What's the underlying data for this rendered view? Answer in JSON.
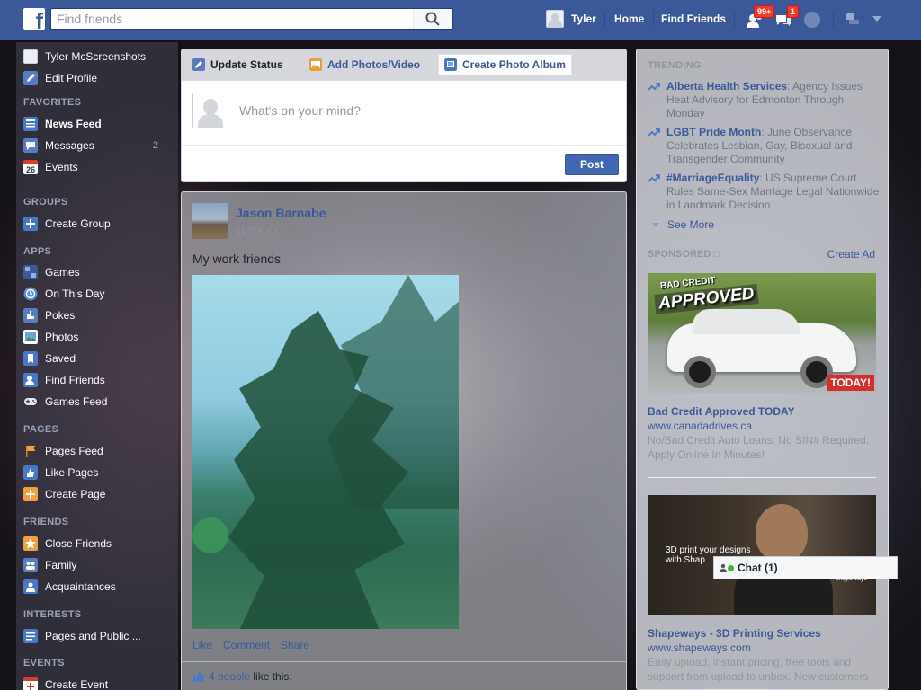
{
  "topbar": {
    "logo": "f",
    "search_placeholder": "Find friends",
    "user_name": "Tyler",
    "home": "Home",
    "find_friends": "Find Friends",
    "friend_requests_badge": "99+",
    "messages_badge": "1"
  },
  "leftnav": {
    "profile_name": "Tyler McScreenshots",
    "edit_profile": "Edit Profile",
    "favorites_head": "FAVORITES",
    "favorites": [
      {
        "label": "News Feed",
        "icon": "news-feed-icon",
        "count": ""
      },
      {
        "label": "Messages",
        "icon": "messages-icon",
        "count": "2"
      },
      {
        "label": "Events",
        "icon": "calendar-icon",
        "count": "",
        "icon_text": "26"
      }
    ],
    "groups_head": "GROUPS",
    "groups": [
      {
        "label": "Create Group",
        "icon": "create-group-icon"
      }
    ],
    "apps_head": "APPS",
    "apps": [
      {
        "label": "Games",
        "icon": "games-icon"
      },
      {
        "label": "On This Day",
        "icon": "on-this-day-icon"
      },
      {
        "label": "Pokes",
        "icon": "pokes-icon"
      },
      {
        "label": "Photos",
        "icon": "photos-icon"
      },
      {
        "label": "Saved",
        "icon": "saved-icon"
      },
      {
        "label": "Find Friends",
        "icon": "find-friends-icon"
      },
      {
        "label": "Games Feed",
        "icon": "games-feed-icon"
      }
    ],
    "pages_head": "PAGES",
    "pages": [
      {
        "label": "Pages Feed",
        "icon": "pages-feed-icon"
      },
      {
        "label": "Like Pages",
        "icon": "like-pages-icon"
      },
      {
        "label": "Create Page",
        "icon": "create-page-icon"
      }
    ],
    "friends_head": "FRIENDS",
    "friends": [
      {
        "label": "Close Friends",
        "icon": "close-friends-icon"
      },
      {
        "label": "Family",
        "icon": "family-icon"
      },
      {
        "label": "Acquaintances",
        "icon": "acquaintances-icon"
      }
    ],
    "interests_head": "INTERESTS",
    "interests": [
      {
        "label": "Pages and Public ...",
        "icon": "interests-icon"
      }
    ],
    "events_head": "EVENTS",
    "events": [
      {
        "label": "Create Event",
        "icon": "create-event-icon"
      }
    ]
  },
  "composer": {
    "tab_status": "Update Status",
    "tab_photos": "Add Photos/Video",
    "tab_album": "Create Photo Album",
    "placeholder": "What's on your mind?",
    "post": "Post"
  },
  "story": {
    "author": "Jason Barnabe",
    "time": "11 hrs",
    "text": "My work friends",
    "like": "Like",
    "comment": "Comment",
    "share": "Share",
    "likes_count": "4 people",
    "likes_suffix": " like this."
  },
  "rightcol": {
    "trending_head": "TRENDING",
    "trends": [
      {
        "topic": "Alberta Health Services",
        "desc": ": Agency Issues Heat Advisory for Edmonton Through Monday"
      },
      {
        "topic": "LGBT Pride Month",
        "desc": ": June Observance Celebrates Lesbian, Gay, Bisexual and Transgender Community"
      },
      {
        "topic": "#MarriageEquality",
        "desc": ": US Supreme Court Rules Same-Sex Marriage Legal Nationwide in Landmark Decision"
      }
    ],
    "see_more": "See More",
    "sponsored": "SPONSORED",
    "create_ad": "Create Ad",
    "ads": [
      {
        "title": "Bad Credit Approved TODAY",
        "url": "www.canadadrives.ca",
        "desc": "No/Bad Credit Auto Loans. No SIN# Required. Apply Online In Minutes!",
        "img_text_1": "BAD CREDIT",
        "img_text_2": "APPROVED",
        "img_text_3": "TODAY!"
      },
      {
        "title": "Shapeways - 3D Printing Services",
        "url": "www.shapeways.com",
        "desc": "Easy upload, instant pricing, free tools and support from upload to unbox. New customers",
        "img_text_1": "3D print your designs",
        "img_text_2": "with Shap",
        "img_text_3": "shapeways"
      }
    ]
  },
  "chat": {
    "label": "Chat (1)"
  }
}
